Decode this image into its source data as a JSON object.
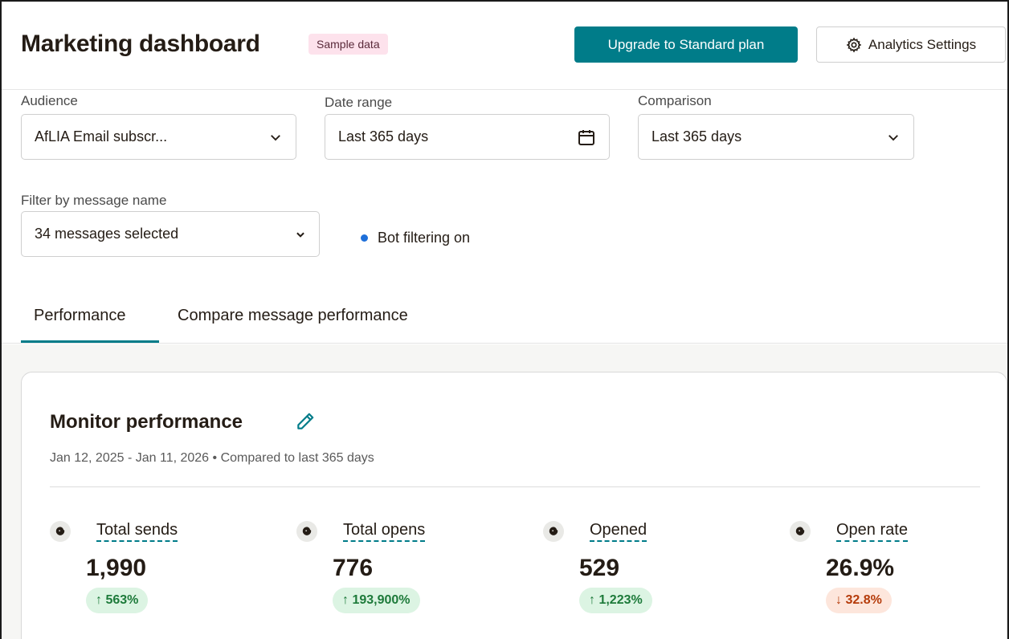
{
  "header": {
    "title": "Marketing dashboard",
    "sample_badge": "Sample data",
    "upgrade_label": "Upgrade to Standard plan",
    "settings_label": "Analytics Settings"
  },
  "filters": {
    "audience": {
      "label": "Audience",
      "value": "AfLIA Email subscr..."
    },
    "date_range": {
      "label": "Date range",
      "value": "Last 365 days"
    },
    "comparison": {
      "label": "Comparison",
      "value": "Last 365 days"
    },
    "message_filter": {
      "label": "Filter by message name",
      "value": "34 messages selected"
    },
    "bot_filtering": "Bot filtering on"
  },
  "tabs": [
    {
      "label": "Performance",
      "active": true
    },
    {
      "label": "Compare message performance",
      "active": false
    }
  ],
  "card": {
    "title": "Monitor performance",
    "subtitle": "Jan 12, 2025 - Jan 11, 2026 • Compared to last 365 days",
    "metrics": [
      {
        "label": "Total sends",
        "value": "1,990",
        "change": "↑ 563%",
        "direction": "up"
      },
      {
        "label": "Total opens",
        "value": "776",
        "change": "↑ 193,900%",
        "direction": "up"
      },
      {
        "label": "Opened",
        "value": "529",
        "change": "↑ 1,223%",
        "direction": "up"
      },
      {
        "label": "Open rate",
        "value": "26.9%",
        "change": "↓ 32.8%",
        "direction": "down"
      }
    ]
  },
  "colors": {
    "accent": "#007c89",
    "positive": "#1d7a3a",
    "negative": "#b53b0a",
    "badge": "#fde2ec",
    "bot_dot": "#1e6fd9"
  },
  "icons": {
    "settings": "gear-icon",
    "date": "calendar-icon",
    "dropdown": "chevron-down-icon",
    "edit": "pencil-icon",
    "metric": "mailchimp-freddie-icon"
  }
}
